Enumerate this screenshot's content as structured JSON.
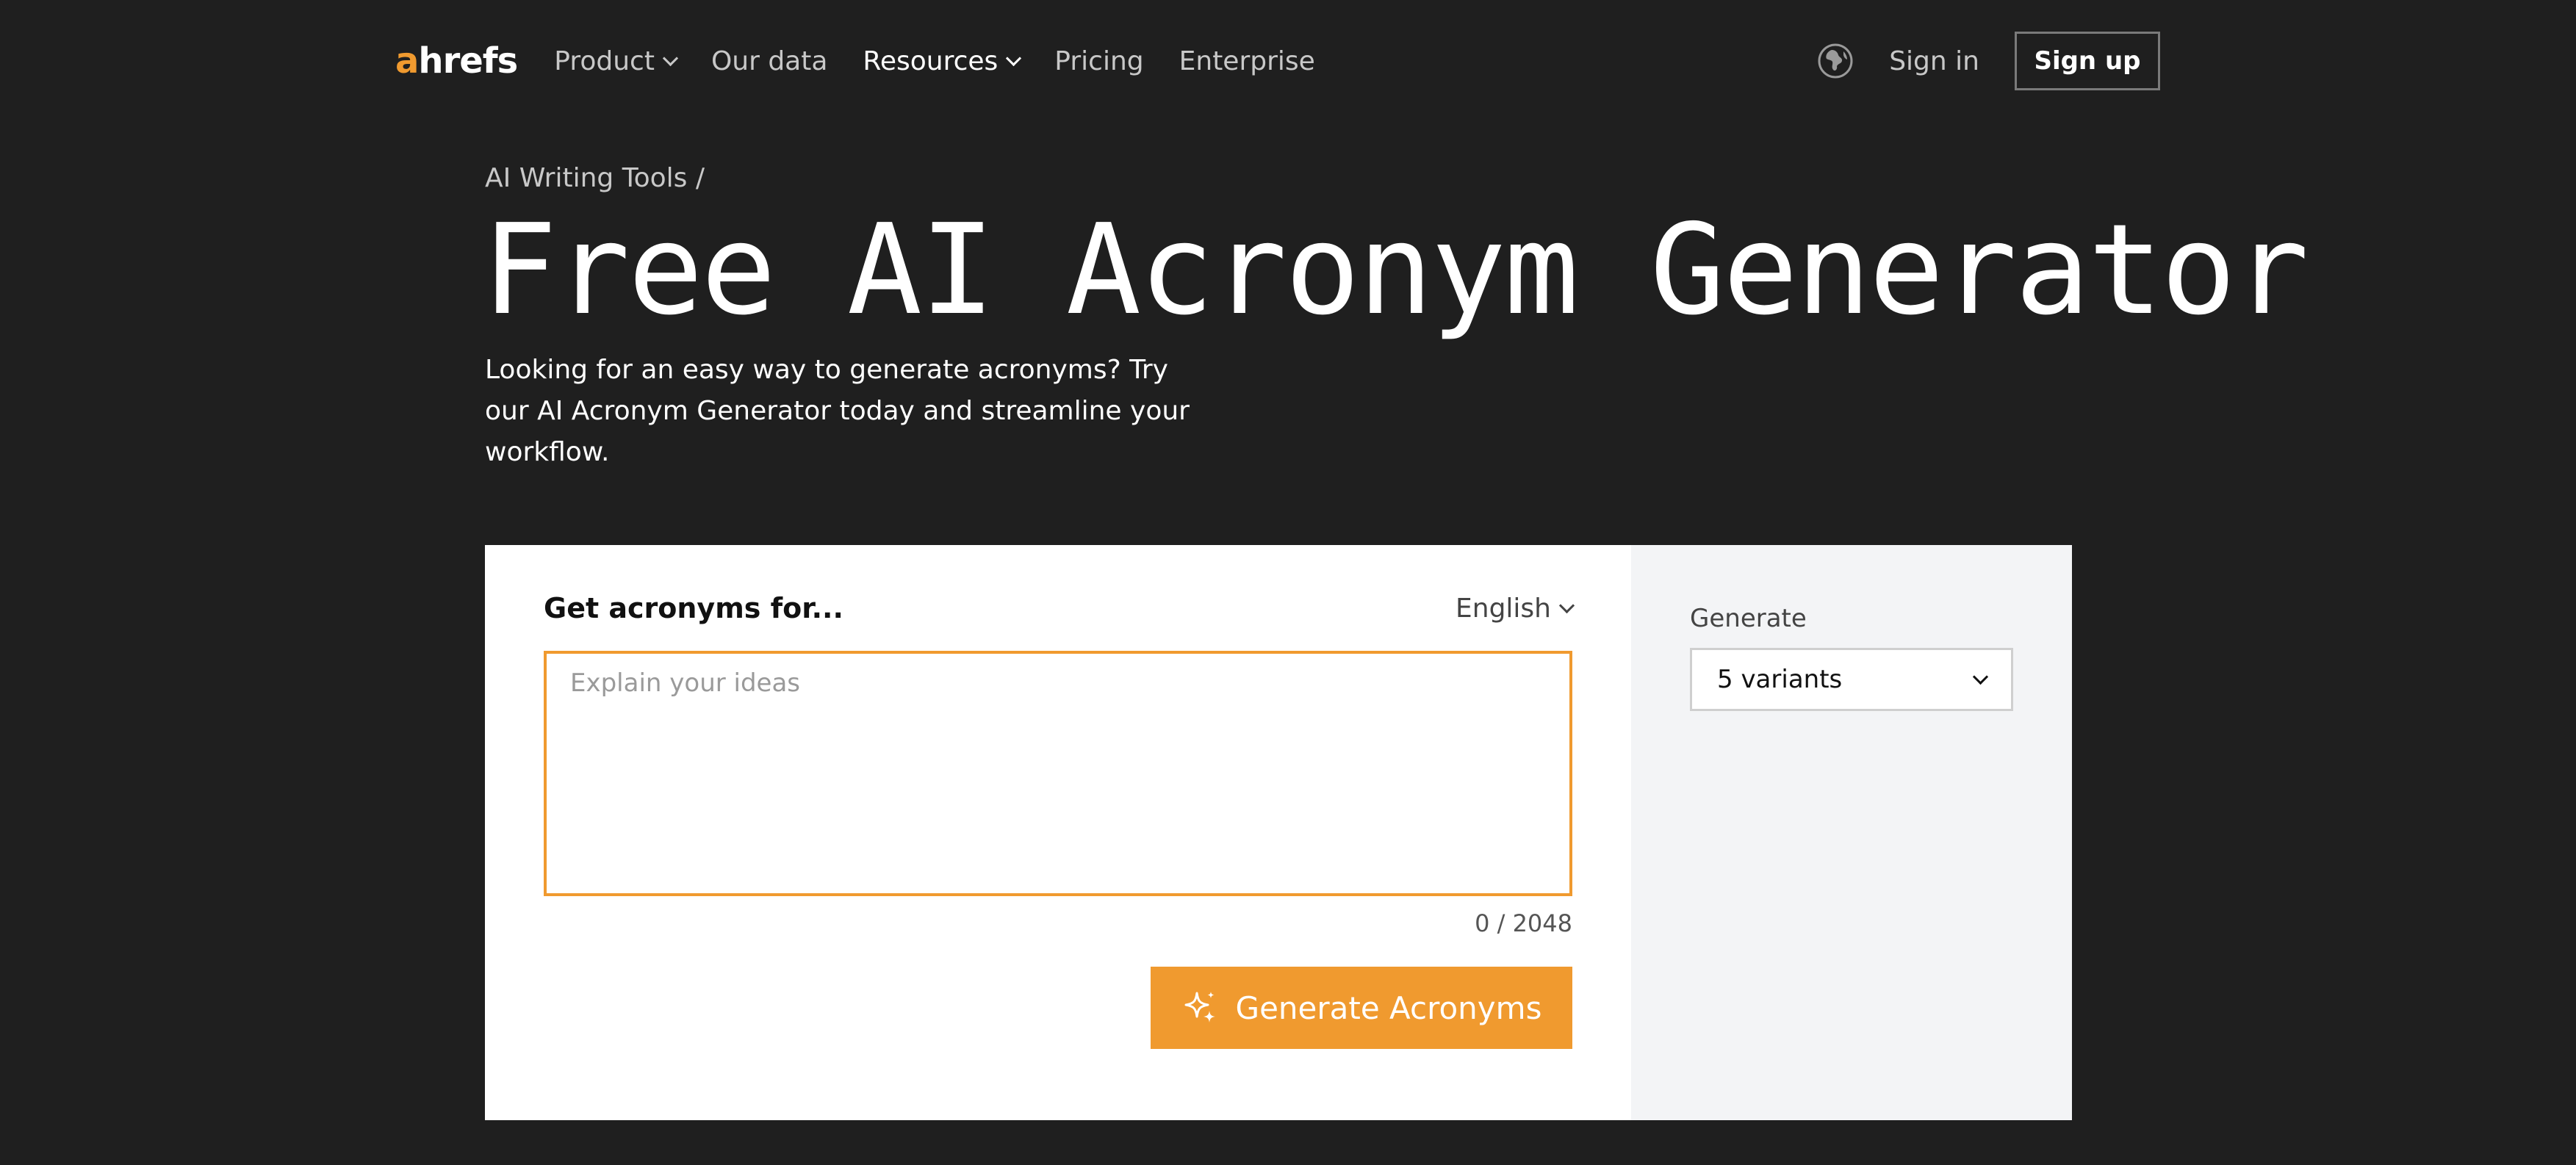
{
  "nav": {
    "logo_accent": "a",
    "logo_rest": "hrefs",
    "links": [
      {
        "label": "Product",
        "has_dropdown": true,
        "active": false
      },
      {
        "label": "Our data",
        "has_dropdown": false,
        "active": false
      },
      {
        "label": "Resources",
        "has_dropdown": true,
        "active": true
      },
      {
        "label": "Pricing",
        "has_dropdown": false,
        "active": false
      },
      {
        "label": "Enterprise",
        "has_dropdown": false,
        "active": false
      }
    ],
    "language_icon": "globe-icon",
    "signin_label": "Sign in",
    "signup_label": "Sign up"
  },
  "hero": {
    "breadcrumb": "AI Writing Tools /",
    "title": "Free AI Acronym Generator",
    "subtitle": "Looking for an easy way to generate acronyms? Try our AI Acronym Generator today and streamline your workflow."
  },
  "tool": {
    "field_label": "Get acronyms for...",
    "language": "English",
    "input_value": "",
    "input_placeholder": "Explain your ideas",
    "char_count": "0 / 2048",
    "generate_icon": "sparkle-icon",
    "generate_label": "Generate Acronyms",
    "side_label": "Generate",
    "variants_value": "5 variants"
  },
  "colors": {
    "background": "#1f1f1f",
    "accent": "#f09a2f",
    "panel": "#ffffff",
    "side_panel": "#f3f4f6"
  }
}
